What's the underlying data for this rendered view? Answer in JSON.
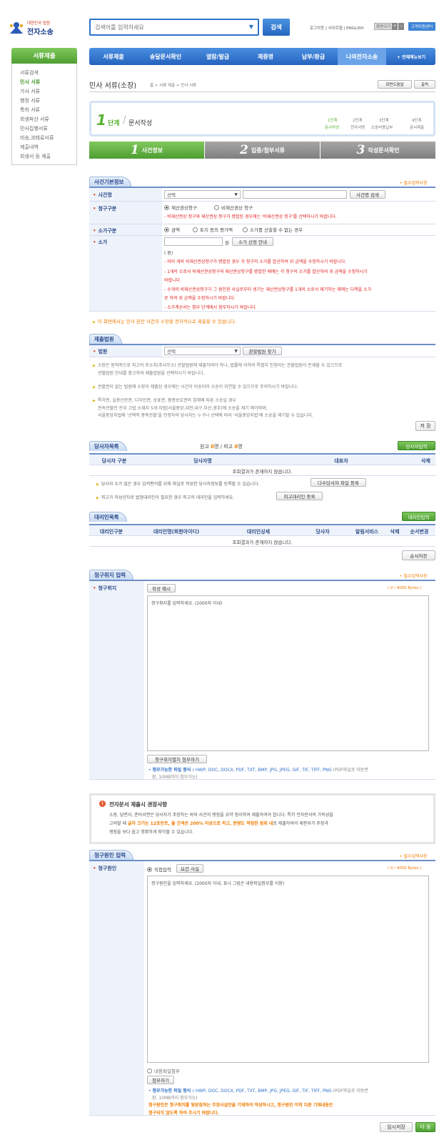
{
  "header": {
    "logo_top": "대한민국 법원",
    "logo_main": "전자소송",
    "search_placeholder": "검색어를 입력하세요",
    "search_button": "검색",
    "util_links": "로그아웃 | 사이트맵 | ENGLISH",
    "screen_size": "화면크기",
    "plus": "+",
    "minus": "-",
    "support": "고객지원센터"
  },
  "nav": {
    "items": [
      "서류제출",
      "송달문서확인",
      "열람/발급",
      "제증명",
      "납부/환급",
      "나의전자소송"
    ],
    "all_menu": "+ 전체메뉴보기"
  },
  "sidebar": {
    "title": "서류제출",
    "items": [
      "서류검색",
      "민사 서류",
      "가사 서류",
      "행정 서류",
      "특허 서류",
      "회생파산 서류",
      "민사집행서류",
      "비송,과태료서류",
      "제출내역",
      "회생서 등 제출"
    ],
    "active_index": 1
  },
  "page": {
    "title": "민사 서류(소장)",
    "breadcrumb": "홈 > 서류 제출 > 민사 서류",
    "help_button": "화면도움말",
    "print_button": "출력"
  },
  "stage": {
    "num": "1",
    "unit": "단계",
    "label": "문서작성",
    "steps": [
      {
        "n": "1단계",
        "t": "문서작성"
      },
      {
        "n": "2단계",
        "t": "전자서명"
      },
      {
        "n": "3단계",
        "t": "소송비용납부"
      },
      {
        "n": "4단계",
        "t": "문서제출"
      }
    ]
  },
  "tabs": [
    {
      "num": "1",
      "label": "사건정보"
    },
    {
      "num": "2",
      "label": "입증/첨부서류"
    },
    {
      "num": "3",
      "label": "작성문서확인"
    }
  ],
  "required_note": "• 필수입력사항",
  "case_info": {
    "title": "사건기본정보",
    "case_name_label": "사건명",
    "case_name_select": "선택",
    "case_name_search": "사건명 검색",
    "claim_type_label": "청구구분",
    "claim_opt1": "재산권상청구",
    "claim_opt2": "비재산권상 청구",
    "claim_note": "- 비재산권상 청구와 재산권상 청구가 병합된 경우에는 '비재산권상 청구'를 선택하시기 바랍니다.",
    "value_type_label": "소가구분",
    "value_opt1": "금액",
    "value_opt2": "토지 등의 평가액",
    "value_opt3": "소가를 산출할 수 없는 경우",
    "value_label": "소가",
    "won": "원",
    "value_calc": "소가 산정 안내",
    "won_paren": "( 원)",
    "notes": [
      "- 여러 개의 비재산권상청구가 병합된 경우 각 청구의 소가를 합산하여 위 금액을 수정하시기 바랍니다.",
      "- 1개의 소로서 비재산권상청구와 재산권상청구를 병합한 때에는 각 청구의 소가를 합산하여 위 금액을 수정하시기",
      "  바랍니다.",
      "- 수개의 비재산권상청구가 그 원인된 사실로부터 생기는 재산권상청구를 1개의 소로서 제기하는 때에는 다액을 소가",
      "  로 하여 위 금액을 수정하시기 바랍니다.",
      "- 소가계산서는 첨부 단계에서 첨부하시기 바랍니다."
    ],
    "electronic_note": "이 화면에서는 민사 본안 사건의 소장을 전자적으로 제출할 수 있습니다."
  },
  "court": {
    "title": "제출법원",
    "label": "법원",
    "select": "선택",
    "find": "관할법원 찾기",
    "notes": [
      [
        "소장은 원칙적으로 피고의 주소지(주사무소) 관할법원에 제출하여야 하나, 법률에 의하여 특별히 인정되는 관할법원이 존재할 수 있으므로",
        "관할법원 안내를 참고하여 제출법원을 선택하시기 바랍니다."
      ],
      [
        "관할권이 없는 법원에 소장이 제출된 경우에는 사건이 이송되어 소송이 지연될 수 있으므로 주의하시기 바랍니다."
      ],
      [
        "특허권, 실용신안권, 디자인권, 상표권, 품종보호권의 침해에 따른 소송일 경우",
        "전속관할인 전국 고법 소재지 5개 지법(서울중앙,대전,대구,부산,광주)에 소송을 제기 해야하며,",
        "서울중앙지법에 '선택적 중복관할'을 인정하여 당사자는 누구나 선택에 따라 '서울중앙지법'에 소송을 제기할 수 있습니다."
      ]
    ],
    "save": "저 장"
  },
  "parties": {
    "title": "당사자목록",
    "count_plaintiff_label": "원고 ",
    "count_plaintiff": "0",
    "count_mid": "명 / 피고 ",
    "count_defendant": "0",
    "count_tail": "명",
    "add_button": "당사자입력",
    "columns": [
      "당사자 구분",
      "당사자명",
      "대표자",
      "삭제"
    ],
    "empty": "조회결과가 존재하지 않습니다.",
    "note1": "당사자 수가 많은 경우 입력편의를 위해 파일로 작성한 당사자정보를 등록할 수 있습니다.",
    "file_button": "다수당사자 파일 등록",
    "note2": "피고가 미성년자로 법정대리인이 필요한 경우 피고의 대리인을 입력하세요.",
    "agent_button": "피고대리인 등록"
  },
  "agents": {
    "title": "대리인목록",
    "add_button": "대리인입력",
    "columns": [
      "대리인구분",
      "대리인명(회원아이디)",
      "대리인상세",
      "당사자",
      "알림서비스",
      "삭제",
      "순서변경"
    ],
    "empty": "조회결과가 존재하지 않습니다.",
    "order_save": "순서저장"
  },
  "purpose": {
    "title": "청구취지 입력",
    "label": "청구취지",
    "example": "작성 예시",
    "counter": "( 0 / 4000 Bytes )",
    "placeholder": "청구취지를 입력하세요. (2000자 이내)",
    "attach": "청구취지별지 첨부하기",
    "file_types_label": "첨부가능한 파일 형식 : ",
    "file_types": "HWP, DOC, DOCX, PDF, TXT, BMP, JPG, JPEG, GIF, TIF, TIFF, PNG",
    "file_types_tail": " (PDF파일로 자동변",
    "file_types_tail2": "환, 10MB까지 첨부가능)"
  },
  "notice": {
    "title": "전자문서 제출시 권장사항",
    "line1": "소장, 답변서, 준비서면은 당사자가 주장하는 바와 사건의 쟁점을 요약 정리하여 제출하여야 합니다. 특히 전자문서의 가독성을",
    "line2a": "고려할 때 ",
    "line2b": "글자 크기는 12포인트, 줄 간격은 200% 이상으로 하고, 분량도 적정한 범위 내",
    "line2c": "로 제출하여야 재판부가 주장과",
    "line3": "쟁점을 보다 쉽고 명확하게 파악할 수 있습니다."
  },
  "cause": {
    "title": "청구원인 입력",
    "label": "청구원인",
    "direct": "직접입력",
    "summary": "요건 사실",
    "counter": "( 0 / 4000 Bytes )",
    "placeholder": "청구원인을 입력하세요. (2000자 이내, 표나 그림은 내용파일첨부를 이용)",
    "file_attach": "내용파일첨부",
    "attach_button": "첨부하기",
    "file_types_label": "첨부가능한 파일 형식 : ",
    "file_types": "HWP, DOC, DOCX, PDF, TXT, BMP, JPG, JPEG, GIF, TIF, TIFF, PNG",
    "file_types_tail": " (PDF파일로 자동변",
    "file_types_tail2": "환, 10MB까지 첨부가능)",
    "warn1": "청구원인은 청구취지를 뒷받침하는 주장사실만을 기재하여 작성하시고, 청구원인 이외 다른 기재내용은",
    "warn2": "청구되지 않도록 하여 주시기 바랍니다."
  },
  "footer": {
    "temp_save": "임시저장",
    "next": "다 음"
  }
}
